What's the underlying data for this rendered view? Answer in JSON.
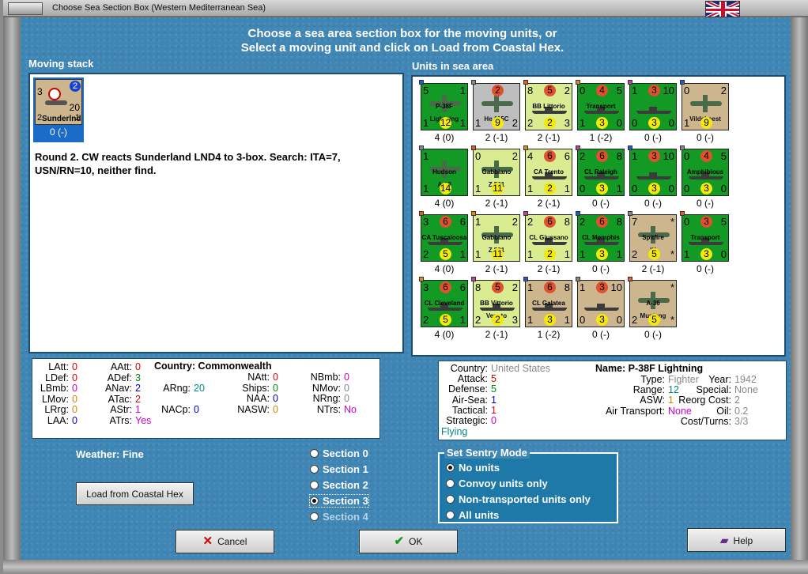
{
  "window": {
    "title": "Choose Sea Section Box (Western Mediterranean Sea)"
  },
  "heading": {
    "line1": "Choose a sea area section box for the moving units, or",
    "line2": "Select a moving unit and click on Load from Coastal Hex."
  },
  "moving_stack": {
    "label": "Moving stack",
    "unit": {
      "tl": "3",
      "tr": "2",
      "mid": "20",
      "bl": "2",
      "name": "Sunderlnd",
      "bl2": "1",
      "caption": "0 (-)"
    },
    "report": "Round 2.  CW reacts Sunderland LND4 to 3-box.  Search:  ITA=7, USN/RN=10, neither find."
  },
  "units_label": "Units in sea area",
  "units": [
    {
      "tl": "5",
      "tm": "",
      "tr": "1",
      "name": "P-38F",
      "name2": "Lightning",
      "bl": "1",
      "bm": "12",
      "br": "1",
      "cap": "4 (0)",
      "bg": "#139a24",
      "kind": "plane"
    },
    {
      "tl": "",
      "tm": "2",
      "tr": "",
      "name": "",
      "name2": "He 115C",
      "bl": "1",
      "bm": "9",
      "br": "2",
      "cap": "2 (-1)",
      "bg": "#bebebe",
      "kind": "plane"
    },
    {
      "tl": "8",
      "tm": "5",
      "tr": "2",
      "name": "BB Littorio",
      "name2": "",
      "bl": "2",
      "bm": "2",
      "br": "3",
      "cap": "2 (-1)",
      "bg": "#d9ec92",
      "kind": "ship"
    },
    {
      "tl": "0",
      "tm": "4",
      "tr": "5",
      "name": "Transport",
      "name2": "",
      "bl": "1",
      "bm": "3",
      "br": "0",
      "cap": "1 (-2)",
      "bg": "#139a24",
      "kind": "ship"
    },
    {
      "tl": "1",
      "tm": "3",
      "tr": "10",
      "name": "",
      "name2": "",
      "bl": "0",
      "bm": "3",
      "br": "0",
      "cap": "0 (-)",
      "bg": "#139a24",
      "kind": "ship"
    },
    {
      "tl": "0",
      "tm": "",
      "tr": "2",
      "name": "",
      "name2": "Vildebeest",
      "bl": "1",
      "bm": "9",
      "br": "",
      "cap": "0 (-)",
      "bg": "#cdb58e",
      "kind": "plane"
    },
    {
      "tl": "1",
      "tm": "",
      "tr": "",
      "name": "Hudson",
      "name2": "A-29",
      "bl": "1",
      "bm": "14",
      "br": "",
      "cap": "4 (0)",
      "bg": "#139a24",
      "kind": "plane"
    },
    {
      "tl": "0",
      "tm": "",
      "tr": "2",
      "name": "Gabbiano",
      "name2": "Z.501",
      "bl": "1",
      "bm": "11",
      "br": "",
      "cap": "2 (-1)",
      "bg": "#d9ec92",
      "kind": "plane"
    },
    {
      "tl": "4",
      "tm": "6",
      "tr": "6",
      "name": "CA Trento",
      "name2": "",
      "bl": "1",
      "bm": "2",
      "br": "1",
      "cap": "2 (-1)",
      "bg": "#d9ec92",
      "kind": "ship"
    },
    {
      "tl": "2",
      "tm": "6",
      "tr": "8",
      "name": "CL Raleigh",
      "name2": "",
      "bl": "0",
      "bm": "3",
      "br": "1",
      "cap": "0 (-)",
      "bg": "#139a24",
      "kind": "ship"
    },
    {
      "tl": "1",
      "tm": "3",
      "tr": "10",
      "name": "",
      "name2": "",
      "bl": "0",
      "bm": "3",
      "br": "0",
      "cap": "0 (-)",
      "bg": "#139a24",
      "kind": "ship"
    },
    {
      "tl": "0",
      "tm": "4",
      "tr": "5",
      "name": "Amphibious",
      "name2": "",
      "bl": "0",
      "bm": "3",
      "br": "0",
      "cap": "0 (-)",
      "bg": "#139a24",
      "kind": "ship"
    },
    {
      "tl": "3",
      "tm": "6",
      "tr": "6",
      "name": "CA Tuscaloosa",
      "name2": "",
      "bl": "2",
      "bm": "5",
      "br": "1",
      "cap": "4 (0)",
      "bg": "#139a24",
      "kind": "ship"
    },
    {
      "tl": "1",
      "tm": "",
      "tr": "2",
      "name": "Gabbiano",
      "name2": "Z.501",
      "bl": "1",
      "bm": "11",
      "br": "",
      "cap": "2 (-1)",
      "bg": "#d9ec92",
      "kind": "plane"
    },
    {
      "tl": "2",
      "tm": "6",
      "tr": "8",
      "name": "CL Giussano",
      "name2": "",
      "bl": "1",
      "bm": "2",
      "br": "1",
      "cap": "2 (-1)",
      "bg": "#d9ec92",
      "kind": "ship"
    },
    {
      "tl": "2",
      "tm": "6",
      "tr": "8",
      "name": "CL Memphis",
      "name2": "",
      "bl": "1",
      "bm": "3",
      "br": "1",
      "cap": "0 (-)",
      "bg": "#139a24",
      "kind": "ship"
    },
    {
      "tl": "7",
      "tm": "",
      "tr": "*",
      "name": "Spitfire",
      "name2": "IX",
      "bl": "2",
      "bm": "5",
      "br": "*",
      "cap": "2 (-1)",
      "bg": "#cdb58e",
      "kind": "plane"
    },
    {
      "tl": "0",
      "tm": "3",
      "tr": "5",
      "name": "Transport",
      "name2": "",
      "bl": "1",
      "bm": "3",
      "br": "0",
      "cap": "0 (-)",
      "bg": "#139a24",
      "kind": "ship"
    },
    {
      "tl": "3",
      "tm": "6",
      "tr": "6",
      "name": "CL Cleveland",
      "name2": "",
      "bl": "2",
      "bm": "5",
      "br": "1",
      "cap": "4 (0)",
      "bg": "#139a24",
      "kind": "ship"
    },
    {
      "tl": "8",
      "tm": "5",
      "tr": "2",
      "name": "BB Vittorio",
      "name2": "Veneto",
      "bl": "2",
      "bm": "2",
      "br": "3",
      "cap": "2 (-1)",
      "bg": "#d9ec92",
      "kind": "ship"
    },
    {
      "tl": "1",
      "tm": "6",
      "tr": "8",
      "name": "CL Galatea",
      "name2": "",
      "bl": "1",
      "bm": "3",
      "br": "1",
      "cap": "1 (-2)",
      "bg": "#cdb58e",
      "kind": "ship"
    },
    {
      "tl": "1",
      "tm": "3",
      "tr": "10",
      "name": "",
      "name2": "",
      "bl": "0",
      "bm": "3",
      "br": "0",
      "cap": "0 (-)",
      "bg": "#cdb58e",
      "kind": "ship"
    },
    {
      "tl": "",
      "tm": "",
      "tr": "*",
      "name": "A-36",
      "name2": "Mustang",
      "bl": "2",
      "bm": "5",
      "br": "*",
      "cap": "0 (-)",
      "bg": "#cdb58e",
      "kind": "plane"
    }
  ],
  "left_stats": {
    "col1": [
      {
        "k": "LAtt:",
        "v": "0",
        "c": "#d00"
      },
      {
        "k": "LDef:",
        "v": "0",
        "c": "#d00"
      },
      {
        "k": "LBmb:",
        "v": "0",
        "c": "#c0c"
      },
      {
        "k": "LMov:",
        "v": "0",
        "c": "#c80"
      },
      {
        "k": "LRrg:",
        "v": "0",
        "c": "#c80"
      },
      {
        "k": "LAA:",
        "v": "0",
        "c": "#00c"
      }
    ],
    "col2": [
      {
        "k": "AAtt:",
        "v": "0",
        "c": "#d00"
      },
      {
        "k": "ADef:",
        "v": "3",
        "c": "#080"
      },
      {
        "k": "ANav:",
        "v": "2",
        "c": "#00c"
      },
      {
        "k": "ATac:",
        "v": "2",
        "c": "#d00"
      },
      {
        "k": "AStr:",
        "v": "1",
        "c": "#c0c"
      },
      {
        "k": "ATrs:",
        "v": "Yes",
        "c": "#c0c"
      }
    ],
    "country_label": "Country: Commonwealth",
    "arng": {
      "k": "ARng:",
      "v": "20",
      "c": "#088"
    },
    "nacp": {
      "k": "NACp:",
      "v": "0",
      "c": "#00c"
    },
    "col4": [
      {
        "k": "NAtt:",
        "v": "0",
        "c": "#d00"
      },
      {
        "k": "Ships:",
        "v": "0",
        "c": "#080"
      },
      {
        "k": "NAA:",
        "v": "0",
        "c": "#00c"
      },
      {
        "k": "NASW:",
        "v": "0",
        "c": "#c80"
      }
    ],
    "col5": [
      {
        "k": "NBmb:",
        "v": "0",
        "c": "#c0c"
      },
      {
        "k": "NMov:",
        "v": "0",
        "c": "#888"
      },
      {
        "k": "NRng:",
        "v": "0",
        "c": "#888"
      },
      {
        "k": "NTrs:",
        "v": "No",
        "c": "#c0c"
      }
    ]
  },
  "right_stats": {
    "rows": [
      {
        "k": "Country:",
        "v": "United States",
        "c": "#888"
      },
      {
        "k": "Attack:",
        "v": "5",
        "c": "#d00"
      },
      {
        "k": "Defense:",
        "v": "5",
        "c": "#080"
      },
      {
        "k": "Air-Sea:",
        "v": "1",
        "c": "#00c"
      },
      {
        "k": "Tactical:",
        "v": "1",
        "c": "#d00"
      },
      {
        "k": "Strategic:",
        "v": "0",
        "c": "#c0c"
      }
    ],
    "flying": "Flying",
    "name": "Name: P-38F Lightning",
    "mid": [
      {
        "k": "Type:",
        "v": "Fighter",
        "c": "#888"
      },
      {
        "k": "Range:",
        "v": "12",
        "c": "#088"
      },
      {
        "k": "ASW:",
        "v": "1",
        "c": "#c80"
      },
      {
        "k": "Air Transport:",
        "v": "None",
        "c": "#c0c"
      }
    ],
    "right": [
      {
        "k": "Year:",
        "v": "1942",
        "c": "#888"
      },
      {
        "k": "Special:",
        "v": "None",
        "c": "#888"
      },
      {
        "k": "Reorg Cost:",
        "v": "2",
        "c": "#888"
      },
      {
        "k": "Oil:",
        "v": "0.2",
        "c": "#888"
      },
      {
        "k": "Cost/Turns:",
        "v": "3/3",
        "c": "#888"
      }
    ]
  },
  "weather": "Weather: Fine",
  "load_button": "Load from Coastal Hex",
  "sections": [
    {
      "label": "Section 0",
      "on": false
    },
    {
      "label": "Section 1",
      "on": false
    },
    {
      "label": "Section 2",
      "on": false
    },
    {
      "label": "Section 3",
      "on": true
    },
    {
      "label": "Section 4",
      "on": false
    }
  ],
  "sentry": {
    "legend": "Set Sentry Mode",
    "options": [
      {
        "label": "No units",
        "on": true
      },
      {
        "label": "Convoy units only",
        "on": false
      },
      {
        "label": "Non-transported units only",
        "on": false
      },
      {
        "label": "All units",
        "on": false
      }
    ]
  },
  "buttons": {
    "cancel": "Cancel",
    "ok": "OK",
    "help": "Help"
  },
  "colors": {
    "accent": "#3f86b5",
    "selected": "#1a6cc8"
  }
}
